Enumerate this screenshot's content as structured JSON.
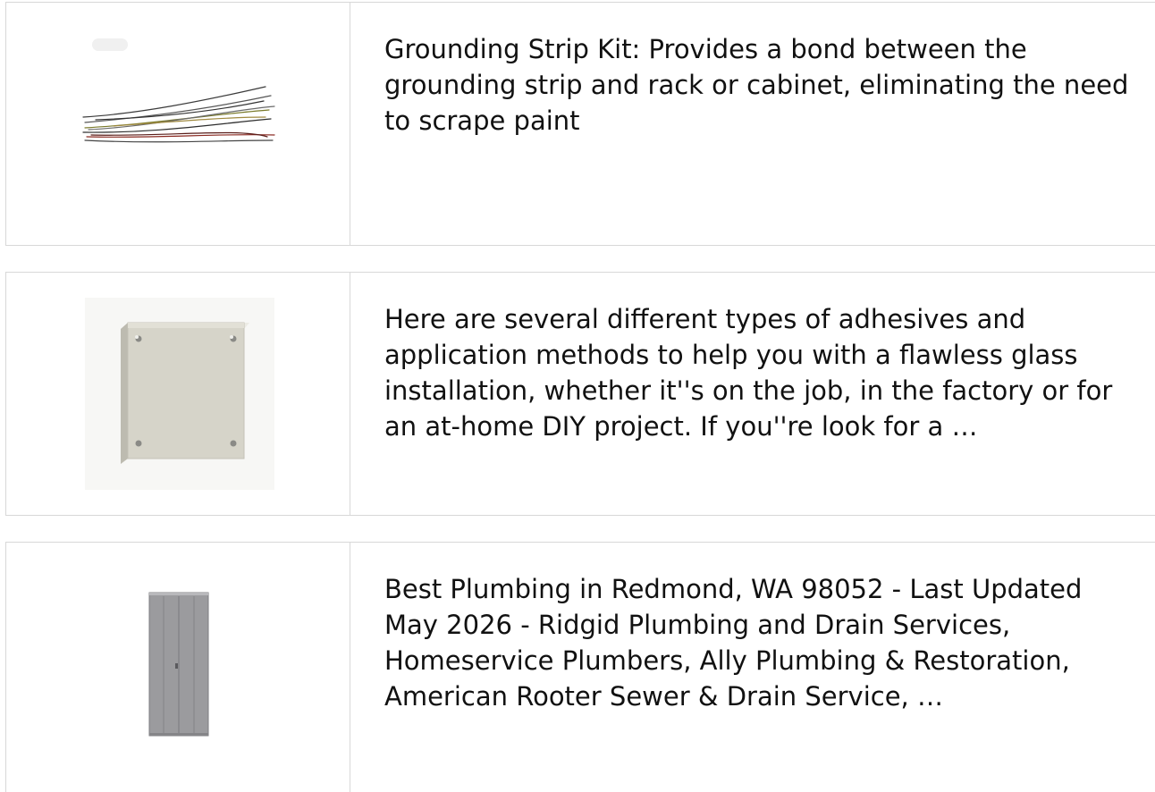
{
  "results": [
    {
      "image_alt": "grounding-wires-image",
      "description": "Grounding Strip Kit: Provides a bond between the grounding strip and rack or cabinet, eliminating the need to scrape paint"
    },
    {
      "image_alt": "steel-enclosure-image",
      "description": "Here are several different types of adhesives and application methods to help you with a flawless glass installation, whether it''s on the job, in the factory or for an at-home DIY project. If you''re look for a …"
    },
    {
      "image_alt": "metal-locker-image",
      "description": "Best Plumbing in Redmond, WA 98052 - Last Updated May 2026 - Ridgid Plumbing and Drain Services, Homeservice Plumbers, Ally Plumbing & Restoration, American Rooter Sewer & Drain Service, …"
    }
  ],
  "colors": {
    "border": "#d8d8d8",
    "text": "#111111",
    "cabinet": "#d9d7cc",
    "locker": "#9a9a9c"
  }
}
